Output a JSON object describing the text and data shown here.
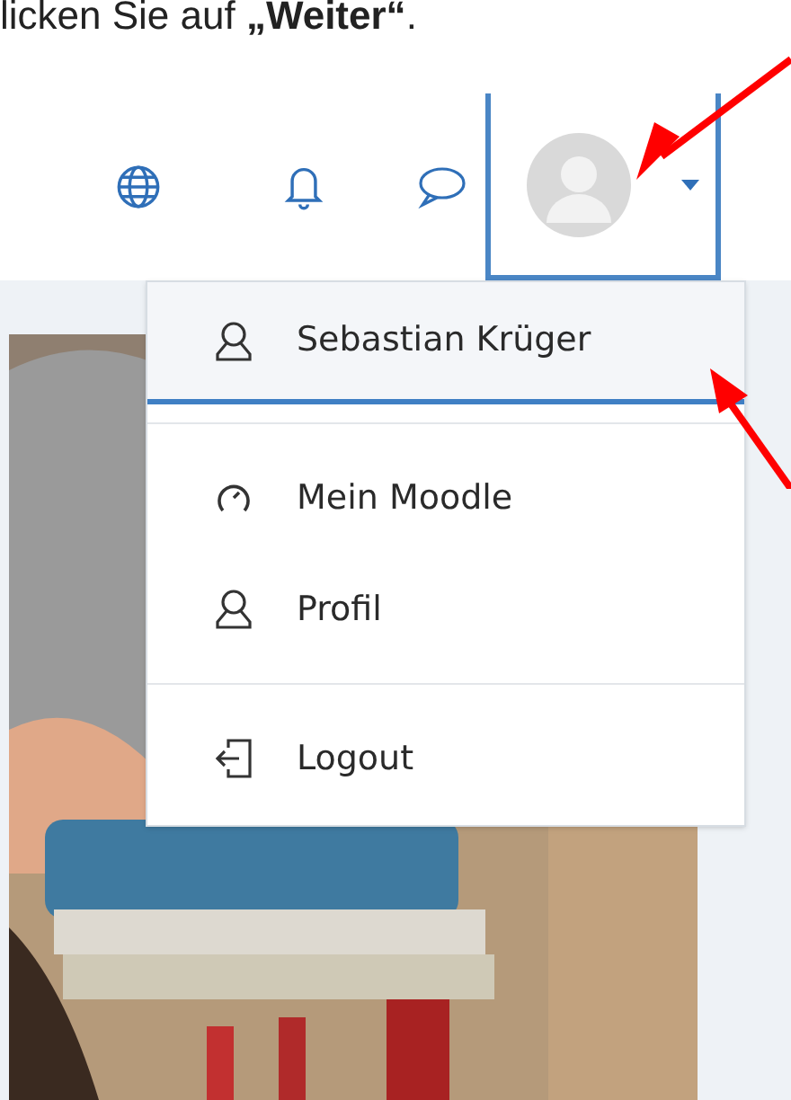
{
  "caption": "licken Sie auf **„Weiter“**.",
  "user_menu": {
    "items": [
      {
        "kind": "item",
        "label": "Sebastian Krüger",
        "selected": true
      },
      {
        "kind": "divider"
      },
      {
        "kind": "item",
        "label": "Mein Moodle",
        "selected": false
      },
      {
        "kind": "item",
        "label": "Profil",
        "selected": false
      },
      {
        "kind": "divider"
      },
      {
        "kind": "item",
        "label": "Logout",
        "selected": false
      }
    ]
  }
}
